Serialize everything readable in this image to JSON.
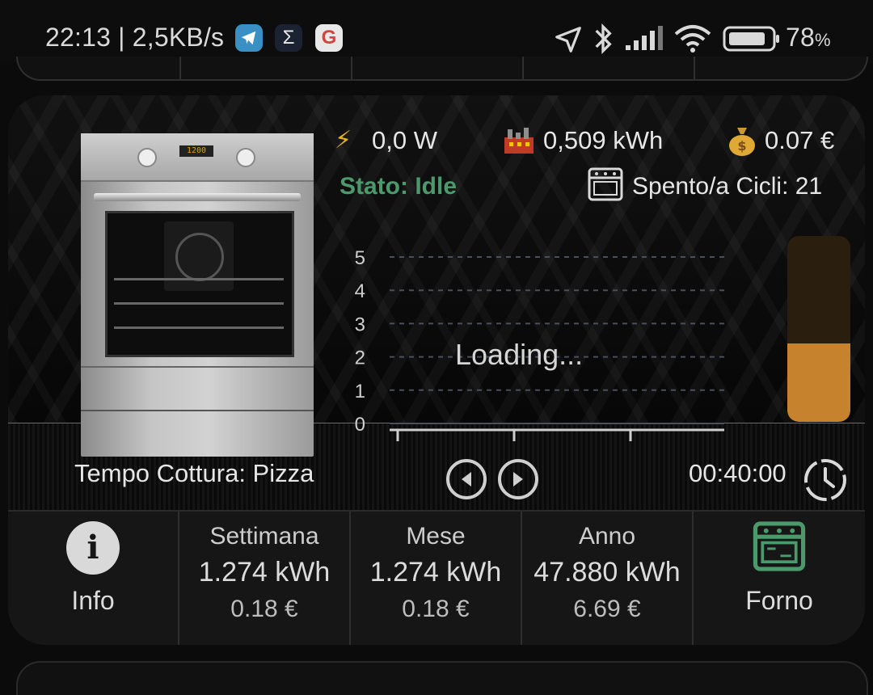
{
  "status_bar": {
    "time_speed": "22:13 | 2,5KB/s",
    "battery": "78",
    "battery_unit": "%",
    "app_icons": [
      "telegram-icon",
      "sigma-icon",
      "google-icon"
    ],
    "system_icons": [
      "location-icon",
      "bluetooth-icon",
      "signal-icon",
      "wifi-icon",
      "battery-icon"
    ]
  },
  "stats": {
    "power": "0,0 W",
    "energy": "0,509 kWh",
    "cost": "0.07 €",
    "state": "Stato: Idle",
    "mode_cycles": "Spento/a  Cicli: 21"
  },
  "chart": {
    "loading": "Loading..."
  },
  "chart_data": {
    "type": "line",
    "y_ticks": [
      "0",
      "1",
      "2",
      "3",
      "4",
      "5"
    ],
    "ylim": [
      0,
      5
    ],
    "x_tick_count": 3,
    "series": [],
    "grid": true
  },
  "gauge": {
    "level_fraction": 0.42,
    "color": "#c6822c"
  },
  "footer": {
    "tempo": "Tempo Cottura: Pizza",
    "timer": "00:40:00"
  },
  "bottom": {
    "info_label": "Info",
    "week": {
      "title": "Settimana",
      "energy": "1.274 kWh",
      "cost": "0.18 €"
    },
    "month": {
      "title": "Mese",
      "energy": "1.274 kWh",
      "cost": "0.18 €"
    },
    "year": {
      "title": "Anno",
      "energy": "47.880 kWh",
      "cost": "6.69 €"
    },
    "device_label": "Forno",
    "device_icon_color": "#4c9a6c"
  }
}
